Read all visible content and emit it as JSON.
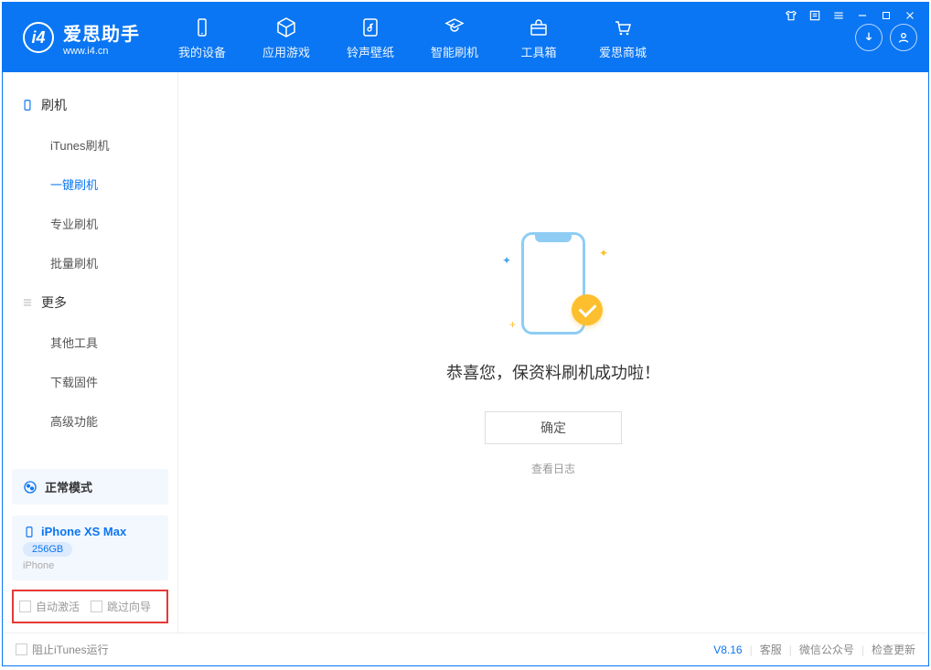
{
  "header": {
    "logo_cn": "爱思助手",
    "logo_en": "www.i4.cn",
    "nav": [
      {
        "label": "我的设备",
        "icon": "device"
      },
      {
        "label": "应用游戏",
        "icon": "cube"
      },
      {
        "label": "铃声壁纸",
        "icon": "music"
      },
      {
        "label": "智能刷机",
        "icon": "refresh"
      },
      {
        "label": "工具箱",
        "icon": "toolbox"
      },
      {
        "label": "爱思商城",
        "icon": "cart"
      }
    ]
  },
  "sidebar": {
    "section1": {
      "title": "刷机"
    },
    "items1": [
      {
        "label": "iTunes刷机"
      },
      {
        "label": "一键刷机"
      },
      {
        "label": "专业刷机"
      },
      {
        "label": "批量刷机"
      }
    ],
    "section2": {
      "title": "更多"
    },
    "items2": [
      {
        "label": "其他工具"
      },
      {
        "label": "下载固件"
      },
      {
        "label": "高级功能"
      }
    ],
    "mode": {
      "label": "正常模式"
    },
    "device": {
      "name": "iPhone XS Max",
      "storage": "256GB",
      "type": "iPhone"
    },
    "checks": {
      "auto_activate": "自动激活",
      "skip_guide": "跳过向导"
    }
  },
  "main": {
    "success_message": "恭喜您，保资料刷机成功啦！",
    "ok_button": "确定",
    "view_log": "查看日志"
  },
  "statusbar": {
    "block_itunes": "阻止iTunes运行",
    "version": "V8.16",
    "support": "客服",
    "wechat": "微信公众号",
    "update": "检查更新"
  }
}
